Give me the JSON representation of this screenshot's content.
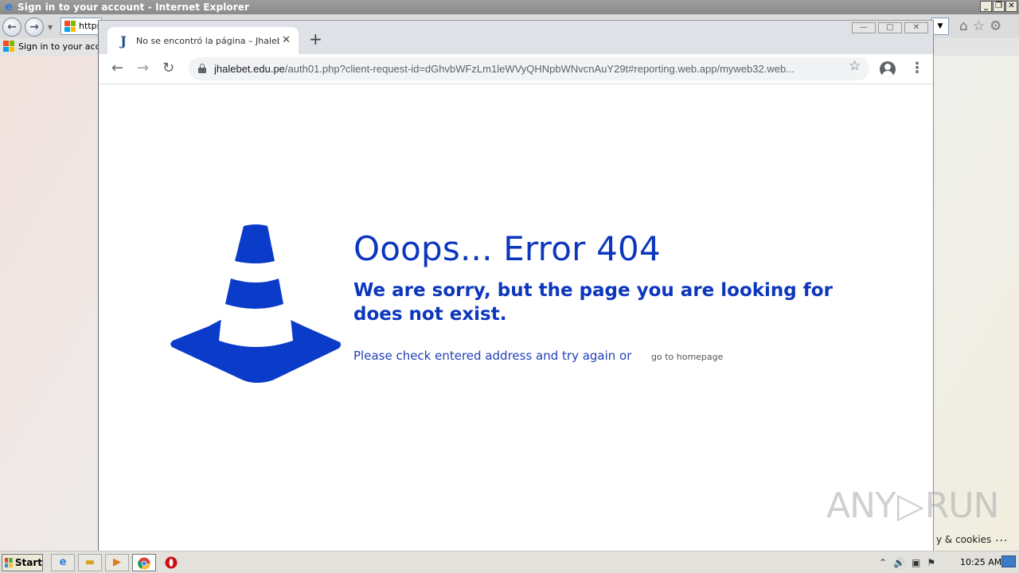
{
  "ie": {
    "title": "Sign in to your account - Internet Explorer",
    "address_partial": "https",
    "fav_tab": "Sign in to your acco",
    "cookies_text": "y & cookies",
    "more": "..."
  },
  "chrome": {
    "tab_favicon": "J",
    "tab_title": "No se encontró la página – Jhalebet",
    "url_host": "jhalebet.edu.pe",
    "url_path": "/auth01.php?client-request-id=dGhvbWFzLm1leWVyQHNpbWNvcnAuY29t#reporting.web.app/myweb32.web..."
  },
  "page": {
    "title": "Ooops... Error 404",
    "subtitle": "We are sorry, but the page you are looking for does not exist.",
    "check_text": "Please check entered address and try again or",
    "homepage_link": "go to homepage"
  },
  "watermark": {
    "left": "ANY",
    "right": "RUN"
  },
  "taskbar": {
    "start_label": "Start",
    "clock": "10:25 AM"
  },
  "colors": {
    "error_blue": "#0c37bd",
    "cone_blue": "#0b3bc9"
  },
  "icons": [
    "ie-icon",
    "back-icon",
    "forward-icon",
    "refresh-icon",
    "lock-icon",
    "star-icon",
    "profile-icon",
    "menu-icon",
    "close-icon",
    "plus-icon",
    "home-icon",
    "gear-icon",
    "traffic-cone-icon",
    "windows-flag-icon",
    "explorer-icon",
    "media-player-icon",
    "chrome-icon",
    "opera-icon"
  ]
}
